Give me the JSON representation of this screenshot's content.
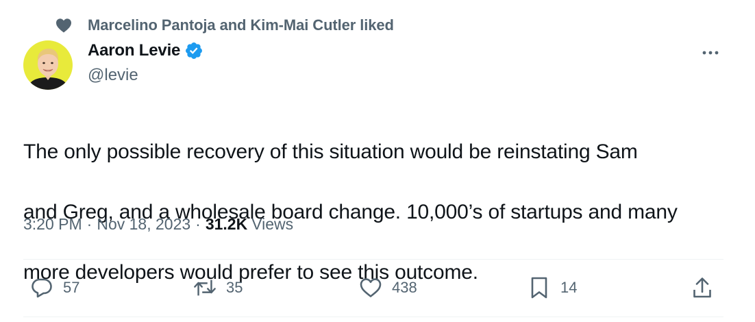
{
  "social_context": {
    "text": "Marcelino Pantoja and Kim-Mai Cutler liked",
    "icon": "heart-icon"
  },
  "author": {
    "display_name": "Aaron Levie",
    "handle": "@levie",
    "verified": true,
    "verified_color": "#1d9bf0",
    "avatar_bg": "#e8ea3b"
  },
  "tweet": {
    "lines": [
      "The only possible recovery of this situation would be reinstating Sam",
      "and Greg, and a wholesale board change. 10,000’s of startups and many",
      "more developers would prefer to see this outcome."
    ],
    "time": "3:20 PM",
    "date": "Nov 18, 2023",
    "separator": "·",
    "views_count": "31.2K",
    "views_label": "Views"
  },
  "actions": {
    "replies": "57",
    "retweets": "35",
    "likes": "438",
    "bookmarks": "14"
  },
  "colors": {
    "text_primary": "#0f1419",
    "text_secondary": "#536471",
    "divider": "#eff3f4"
  }
}
